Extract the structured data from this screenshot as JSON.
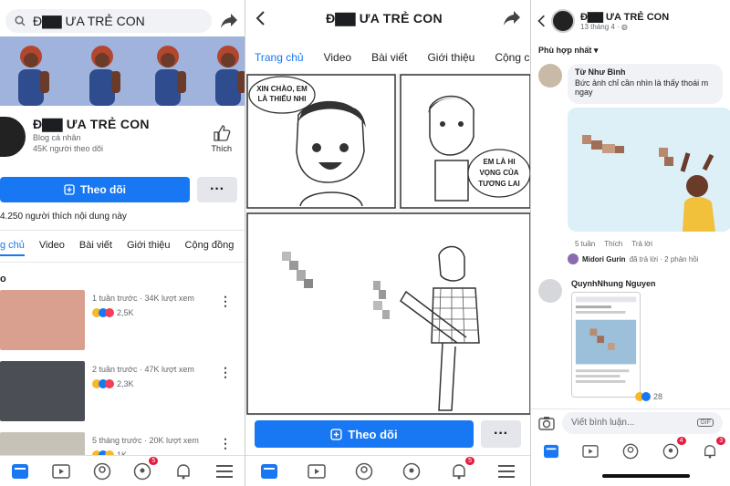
{
  "page_name": "Đ▇▇ ƯA TRẺ CON",
  "panel1": {
    "search_value": "Đ▇▇ ƯA TRẺ CON",
    "category": "Blog cá nhân",
    "followers": "45K người theo dõi",
    "like_label": "Thích",
    "follow_label": "Theo dõi",
    "more_label": "···",
    "likes_line": "4.250 người thích nội dung này",
    "tabs": [
      "g chủ",
      "Video",
      "Bài viết",
      "Giới thiệu",
      "Cộng đồng"
    ],
    "section_label": "o",
    "videos": [
      {
        "meta": "1 tuần trước · 34K lượt xem",
        "count": "2,5K",
        "thumb_color": "#d9a08f"
      },
      {
        "meta": "2 tuần trước · 47K lượt xem",
        "count": "2,3K",
        "thumb_color": "#4b4e55"
      },
      {
        "meta": "5 tháng trước · 20K lượt xem",
        "count": "1K",
        "thumb_color": "#c7c2b8"
      }
    ],
    "nav_badge": "5"
  },
  "panel2": {
    "title": "Đ▇▇ ƯA TRẺ CON",
    "tabs": [
      "Trang chủ",
      "Video",
      "Bài viết",
      "Giới thiệu",
      "Cộng c"
    ],
    "bubble1": "XIN CHÀO, EM\nLÀ THIẾU NHI",
    "bubble2": "EM LÀ HI\nVỌNG CỦA\nTƯƠNG LAI",
    "follow_label": "Theo dõi",
    "more_label": "···",
    "nav_badge": "5"
  },
  "panel3": {
    "name": "Đ▇▇ ƯA TRẺ CON",
    "date": "13 tháng 4 · ",
    "sort_label": "Phù hợp nhất ▾",
    "comment1": {
      "author": "Từ Như Bình",
      "text": "Bức ảnh chỉ cần nhìn là thấy thoái m ngay",
      "time": "5 tuần",
      "like": "Thích",
      "reply": "Trả lời",
      "reply_author": "Midori Gurin",
      "reply_text": " đã trả lời · 2 phản hồi"
    },
    "comment2": {
      "author": "QuynhNhung Nguyen",
      "reaction_count": "28"
    },
    "input_placeholder": "Viết bình luận...",
    "gif_label": "GIF",
    "badge_groups": "4",
    "badge_bell": "3"
  },
  "colors": {
    "brand": "#1877f2",
    "badge": "#e41e3f"
  }
}
